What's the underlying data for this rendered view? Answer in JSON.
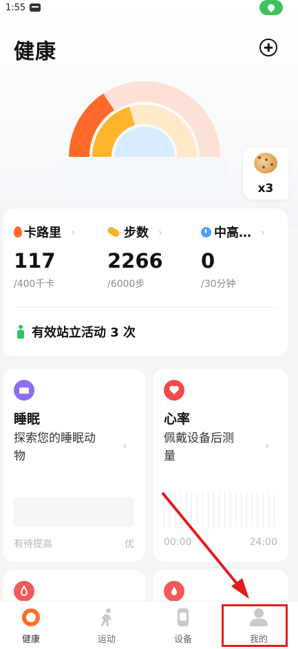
{
  "status_bar": {
    "time": "1:55"
  },
  "header": {
    "title": "健康"
  },
  "rings_colors": {
    "outer": "#fde0d6",
    "middle": "#ffe9c9",
    "inner": "#d9ecff",
    "outer_active": "#ff6a2a",
    "middle_active": "#ffb52b"
  },
  "badge": {
    "count": "x3"
  },
  "stats": [
    {
      "label": "卡路里",
      "value": "117",
      "goal": "/400千卡",
      "icon": "fire-icon"
    },
    {
      "label": "步数",
      "value": "2266",
      "goal": "/6000步",
      "icon": "step-icon"
    },
    {
      "label": "中高…",
      "value": "0",
      "goal": "/30分钟",
      "icon": "clock-icon"
    }
  ],
  "stand": {
    "text": "有效站立活动 3 次"
  },
  "sleep_card": {
    "title": "睡眠",
    "desc_line1": "探索您的睡眠动",
    "desc_line2": "物",
    "foot_left": "有待提高",
    "foot_right": "优"
  },
  "heart_card": {
    "title": "心率",
    "desc_line1": "佩戴设备后测",
    "desc_line2": "量",
    "foot_left": "00:00",
    "foot_right": "24:00"
  },
  "tabs": [
    {
      "label": "健康"
    },
    {
      "label": "运动"
    },
    {
      "label": "设备"
    },
    {
      "label": "我的"
    }
  ]
}
